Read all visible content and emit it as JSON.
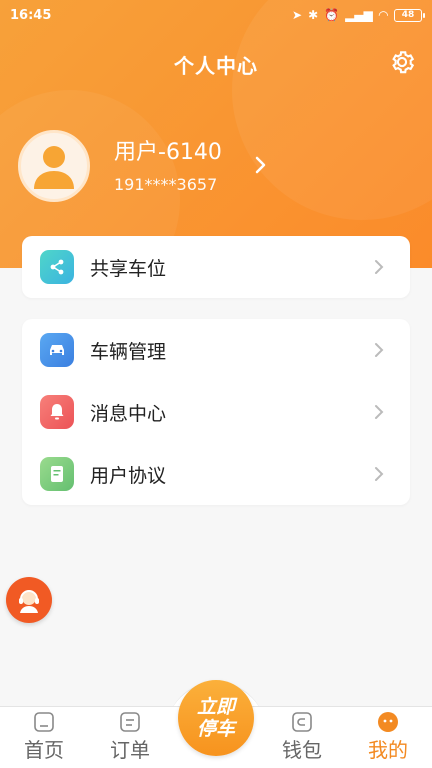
{
  "status_bar": {
    "time": "16:45",
    "battery": "48"
  },
  "header": {
    "title": "个人中心"
  },
  "profile": {
    "name": "用户-6140",
    "phone": "191****3657"
  },
  "menu_primary": [
    {
      "label": "共享车位",
      "icon": "share-icon",
      "color": "#3cc8c8"
    }
  ],
  "menu_secondary": [
    {
      "label": "车辆管理",
      "icon": "car-icon",
      "color": "#3b8fe8"
    },
    {
      "label": "消息中心",
      "icon": "bell-icon",
      "color": "#f0605d"
    },
    {
      "label": "用户协议",
      "icon": "document-icon",
      "color": "#76c776"
    }
  ],
  "bottom_nav": {
    "home": "首页",
    "orders": "订单",
    "park_now": [
      "立即",
      "停车"
    ],
    "wallet": "钱包",
    "mine": "我的"
  },
  "colors": {
    "accent": "#f38a22",
    "header": "#fb8b2a"
  }
}
